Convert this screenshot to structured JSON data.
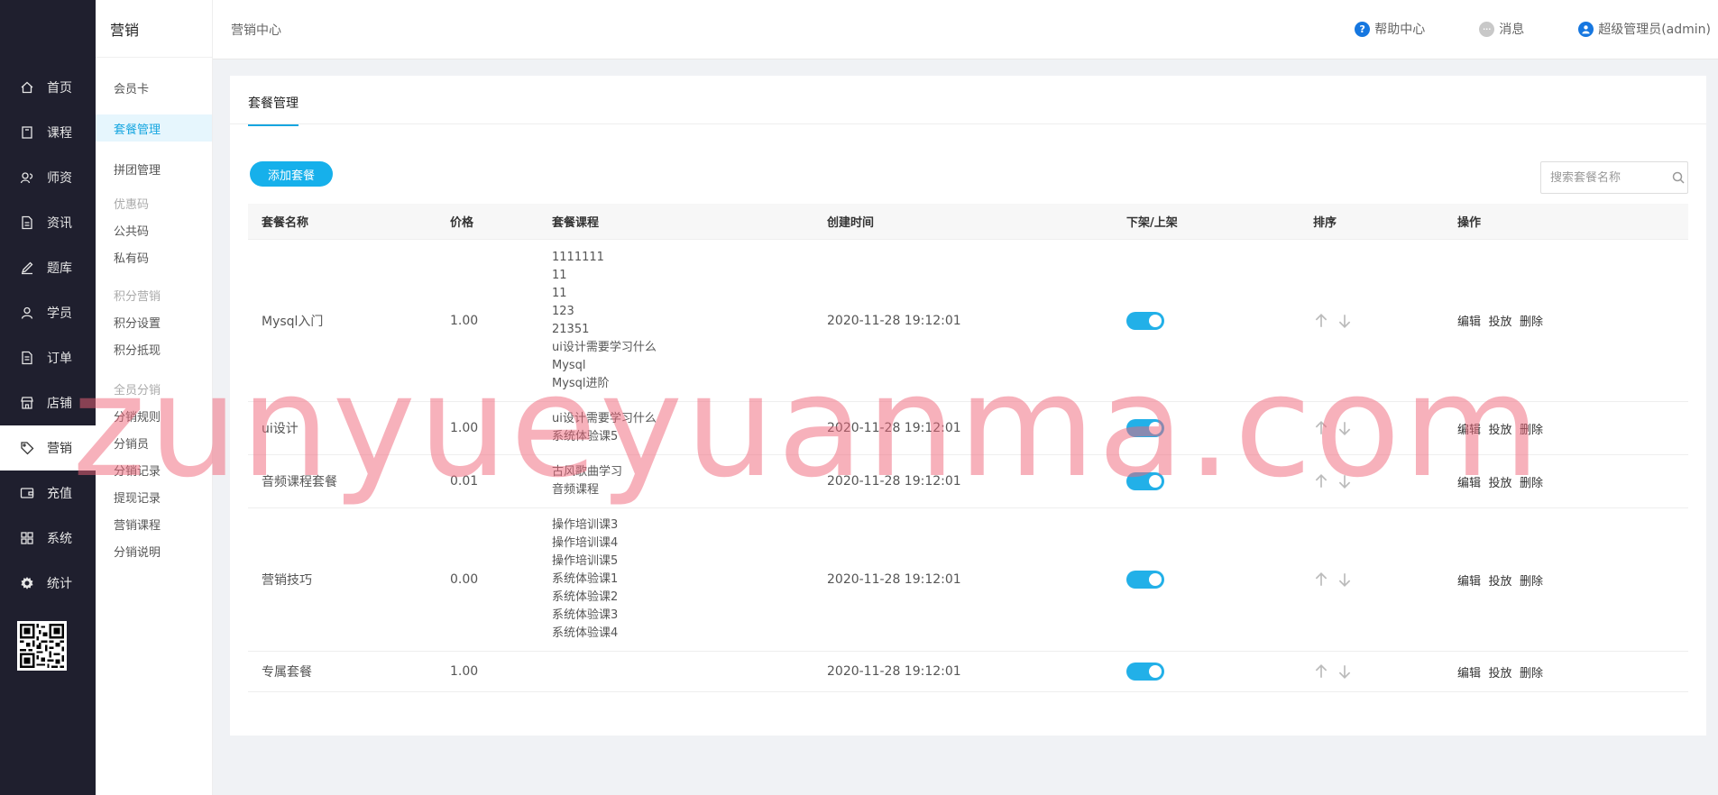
{
  "nav": {
    "items": [
      {
        "label": "首页",
        "icon": "home-icon"
      },
      {
        "label": "课程",
        "icon": "book-icon"
      },
      {
        "label": "师资",
        "icon": "teacher-icon"
      },
      {
        "label": "资讯",
        "icon": "news-icon"
      },
      {
        "label": "题库",
        "icon": "pen-icon"
      },
      {
        "label": "学员",
        "icon": "user-icon"
      },
      {
        "label": "订单",
        "icon": "order-icon"
      },
      {
        "label": "店铺",
        "icon": "shop-icon"
      },
      {
        "label": "营销",
        "icon": "tag-icon"
      },
      {
        "label": "充值",
        "icon": "wallet-icon"
      },
      {
        "label": "系统",
        "icon": "grid-icon"
      },
      {
        "label": "统计",
        "icon": "gear-icon"
      }
    ],
    "active": "营销"
  },
  "subnav": {
    "title": "营销",
    "member_card": "会员卡",
    "package_mgmt": "套餐管理",
    "group_buy": "拼团管理",
    "coupon_group": "优惠码",
    "public_code": "公共码",
    "private_code": "私有码",
    "points_group": "积分营销",
    "points_settings": "积分设置",
    "points_offset": "积分抵现",
    "distribution_group": "全员分销",
    "distribution_rules": "分销规则",
    "distributors": "分销员",
    "distribution_records": "分销记录",
    "withdraw_records": "提现记录",
    "marketing_courses": "营销课程",
    "distribution_desc": "分销说明"
  },
  "topbar": {
    "breadcrumb": "营销中心",
    "help": "帮助中心",
    "messages": "消息",
    "user": "超级管理员(admin)"
  },
  "main": {
    "tab": "套餐管理",
    "add_button": "添加套餐",
    "search_placeholder": "搜索套餐名称",
    "columns": [
      "套餐名称",
      "价格",
      "套餐课程",
      "创建时间",
      "下架/上架",
      "排序",
      "操作"
    ],
    "ops": {
      "edit": "编辑",
      "publish": "投放",
      "delete": "删除"
    },
    "rows": [
      {
        "name": "Mysql入门",
        "price": "1.00",
        "courses": [
          "1111111",
          "11",
          "11",
          "123",
          "21351",
          "ui设计需要学习什么",
          "Mysql",
          "Mysql进阶"
        ],
        "created": "2020-11-28 19:12:01",
        "on_shelf": true
      },
      {
        "name": "ui设计",
        "price": "1.00",
        "courses": [
          "ui设计需要学习什么",
          "系统体验课5"
        ],
        "created": "2020-11-28 19:12:01",
        "on_shelf": true
      },
      {
        "name": "音频课程套餐",
        "price": "0.01",
        "courses": [
          "古风歌曲学习",
          "音频课程"
        ],
        "created": "2020-11-28 19:12:01",
        "on_shelf": true
      },
      {
        "name": "营销技巧",
        "price": "0.00",
        "courses": [
          "操作培训课3",
          "操作培训课4",
          "操作培训课5",
          "系统体验课1",
          "系统体验课2",
          "系统体验课3",
          "系统体验课4"
        ],
        "created": "2020-11-28 19:12:01",
        "on_shelf": true
      },
      {
        "name": "专属套餐",
        "price": "1.00",
        "courses": [],
        "created": "2020-11-28 19:12:01",
        "on_shelf": true
      }
    ]
  },
  "watermark": "zunyueyuanma.com",
  "colors": {
    "accent": "#16b0eb",
    "nav_bg": "#1f1f2e",
    "watermark": "#f06478"
  }
}
